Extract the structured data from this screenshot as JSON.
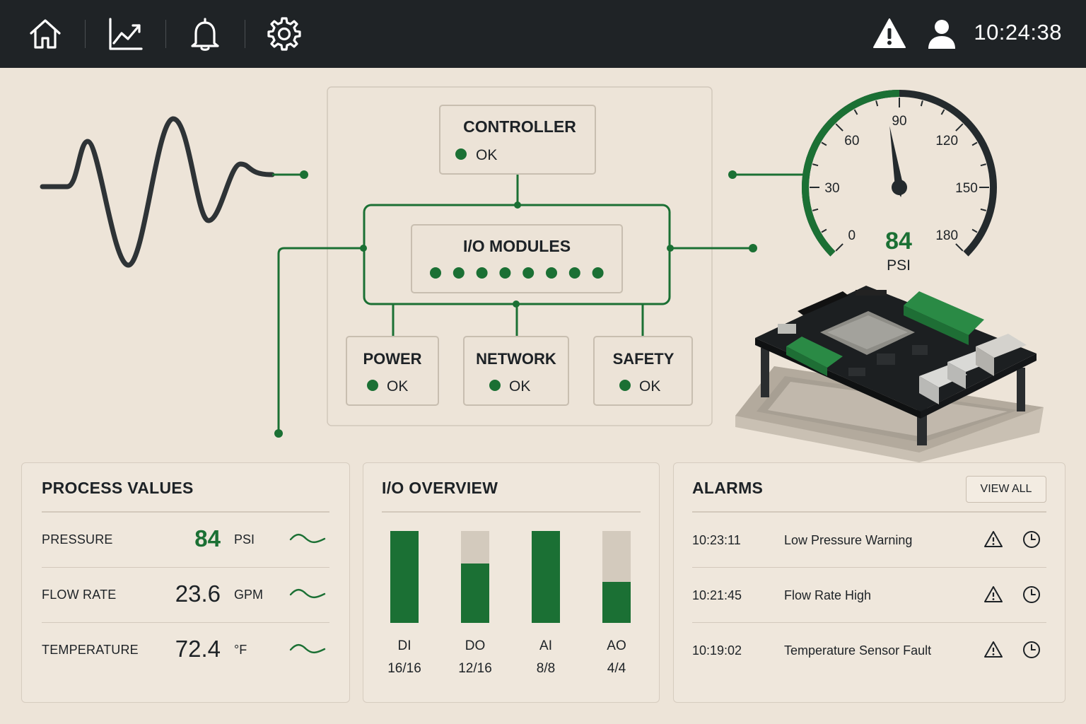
{
  "topbar": {
    "nav_icons": [
      "home-icon",
      "trend-chart-icon",
      "bell-icon",
      "gear-icon"
    ],
    "status_icons": [
      "warning-icon",
      "user-icon"
    ],
    "time": "10:24:38"
  },
  "diagram": {
    "controller": {
      "title": "CONTROLLER",
      "status": "OK"
    },
    "io_modules": {
      "title": "I/O MODULES",
      "indicator_count": 8
    },
    "power": {
      "title": "POWER",
      "status": "OK"
    },
    "network": {
      "title": "NETWORK",
      "status": "OK"
    },
    "safety": {
      "title": "SAFETY",
      "status": "OK"
    }
  },
  "gauge": {
    "value": "84",
    "unit": "PSI",
    "min": 0,
    "max": 180,
    "ticks": [
      "0",
      "30",
      "60",
      "90",
      "120",
      "150",
      "180"
    ]
  },
  "process_values": {
    "title": "PROCESS VALUES",
    "rows": [
      {
        "label": "PRESSURE",
        "value": "84",
        "unit": "PSI",
        "highlight": true
      },
      {
        "label": "FLOW RATE",
        "value": "23.6",
        "unit": "GPM",
        "highlight": false
      },
      {
        "label": "TEMPERATURE",
        "value": "72.4",
        "unit": "°F",
        "highlight": false
      }
    ]
  },
  "io_overview": {
    "title": "I/O OVERVIEW",
    "channels": [
      {
        "name": "DI",
        "count": "16/16",
        "fill": 1.0
      },
      {
        "name": "DO",
        "count": "12/16",
        "fill": 0.65
      },
      {
        "name": "AI",
        "count": "8/8",
        "fill": 1.0
      },
      {
        "name": "AO",
        "count": "4/4",
        "fill": 0.45
      }
    ]
  },
  "alarms": {
    "title": "ALARMS",
    "view_all": "VIEW ALL",
    "rows": [
      {
        "time": "10:23:11",
        "message": "Low Pressure Warning"
      },
      {
        "time": "10:21:45",
        "message": "Flow Rate High"
      },
      {
        "time": "10:19:02",
        "message": "Temperature Sensor Fault"
      }
    ]
  },
  "colors": {
    "accent_green": "#1b7034",
    "topbar_bg": "#1f2326",
    "background": "#ede4d8",
    "dark_line": "#2e3336"
  }
}
